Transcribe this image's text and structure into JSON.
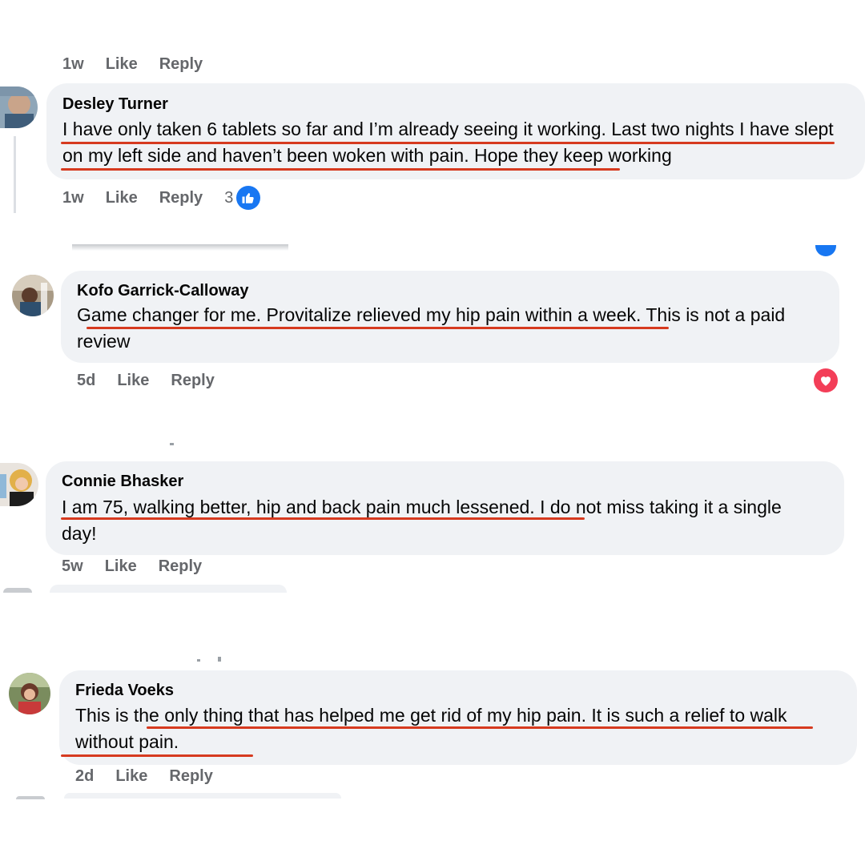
{
  "comments": [
    {
      "top_meta": {
        "time": "1w",
        "like": "Like",
        "reply": "Reply"
      }
    },
    {
      "author": "Desley Turner",
      "text": "I have only taken 6 tablets so far and I’m already seeing it working. Last two nights I have slept on my left side and haven’t been woken with pain. Hope they keep working",
      "time": "1w",
      "like": "Like",
      "reply": "Reply",
      "reaction_count": "3",
      "reaction": "like-icon"
    },
    {
      "author": "Kofo Garrick-Calloway",
      "text": "Game changer for me. Provitalize relieved my hip pain within a week. This is not a paid review",
      "time": "5d",
      "like": "Like",
      "reply": "Reply",
      "reaction": "love-icon"
    },
    {
      "author": "Connie Bhasker",
      "text": "I am 75, walking better, hip and back pain much lessened. I do not miss taking it a single day!",
      "time": "5w",
      "like": "Like",
      "reply": "Reply"
    },
    {
      "author": "Frieda Voeks",
      "text": "This is the only thing that has helped me get rid of my hip pain. It is such a relief to walk without pain.",
      "time": "2d",
      "like": "Like",
      "reply": "Reply"
    }
  ],
  "colors": {
    "bubble": "#f0f2f5",
    "underline": "#d63a1f",
    "meta_text": "#65676b",
    "like_badge": "#1877f2",
    "love_badge": "#f33e58"
  }
}
